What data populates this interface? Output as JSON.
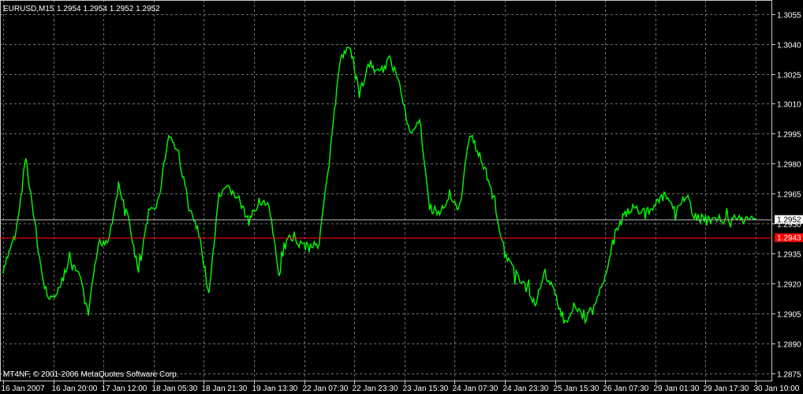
{
  "header": {
    "symbol_timeframe": "EURUSD,M15",
    "ohlc": "1.2954 1.2954 1.2952 1.2952"
  },
  "footer": {
    "copyright": "MT4NF, © 2001-2006 MetaQuotes Software Corp."
  },
  "colors": {
    "background": "#000000",
    "grid": "#6f6f6f",
    "price_line": "#00ff00",
    "bid_line": "#b0b0b0",
    "marker_line": "#ff0000",
    "marker_label_bg": "#ff0000",
    "current_label_bg": "#ffffff"
  },
  "chart_data": {
    "type": "line",
    "title": "EURUSD,M15",
    "ylim": [
      1.2871,
      1.3062
    ],
    "yticks": [
      "1.3055",
      "1.3040",
      "1.3025",
      "1.3010",
      "1.2995",
      "1.2980",
      "1.2965",
      "1.2950",
      "1.2935",
      "1.2920",
      "1.2905",
      "1.2890",
      "1.2875"
    ],
    "xticks": [
      "16 Jan 2007",
      "16 Jan 20:00",
      "17 Jan 12:00",
      "18 Jan 05:30",
      "18 Jan 21:30",
      "19 Jan 13:30",
      "22 Jan 07:30",
      "22 Jan 23:30",
      "23 Jan 15:30",
      "24 Jan 07:30",
      "24 Jan 23:30",
      "25 Jan 15:30",
      "26 Jan 07:30",
      "29 Jan 01:30",
      "29 Jan 17:30",
      "30 Jan 10:00"
    ],
    "current_price": "1.2952",
    "marker_price": "1.2943",
    "grid": true,
    "series": [
      {
        "x_tick_index": [
          0.0,
          0.3,
          0.45,
          0.6,
          0.8,
          0.95,
          1.1,
          1.3,
          1.5,
          1.7,
          1.9,
          2.1,
          2.3,
          2.5,
          2.7,
          2.9,
          3.1,
          3.3,
          3.5,
          3.7,
          3.9,
          4.1,
          4.3,
          4.5,
          4.7,
          4.9,
          5.1,
          5.3,
          5.5,
          5.7,
          5.9,
          6.1,
          6.3,
          6.5,
          6.7,
          6.9,
          7.0,
          7.1,
          7.3,
          7.5,
          7.7,
          7.9,
          8.1,
          8.3,
          8.5,
          8.7,
          8.9,
          9.1,
          9.3,
          9.4,
          9.6,
          9.8,
          10.0,
          10.2,
          10.4,
          10.6,
          10.8,
          11.0,
          11.2,
          11.4,
          11.6,
          11.8,
          12.0,
          12.2,
          12.4,
          12.6,
          12.8,
          13.0,
          13.2,
          13.4,
          13.6,
          13.8,
          14.0,
          14.2,
          14.4,
          14.6,
          14.8,
          15.0
        ],
        "y": [
          1.2925,
          1.2952,
          1.2984,
          1.2955,
          1.292,
          1.2912,
          1.2916,
          1.293,
          1.2925,
          1.2905,
          1.294,
          1.2942,
          1.2969,
          1.2952,
          1.2925,
          1.2955,
          1.2962,
          1.2995,
          1.2985,
          1.2958,
          1.2945,
          1.2915,
          1.2963,
          1.2968,
          1.2962,
          1.295,
          1.2962,
          1.2958,
          1.2925,
          1.2945,
          1.294,
          1.2938,
          1.2942,
          1.298,
          1.303,
          1.304,
          1.3028,
          1.3015,
          1.303,
          1.3025,
          1.3032,
          1.3022,
          1.2995,
          1.3003,
          1.2958,
          1.2955,
          1.2962,
          1.2958,
          1.2995,
          1.299,
          1.2978,
          1.296,
          1.2935,
          1.2925,
          1.292,
          1.291,
          1.2925,
          1.2915,
          1.29,
          1.291,
          1.2902,
          1.2908,
          1.2925,
          1.2945,
          1.2955,
          1.2958,
          1.2955,
          1.296,
          1.2964,
          1.2955,
          1.2965,
          1.2953,
          1.2952,
          1.2952,
          1.2952,
          1.2952,
          1.2952,
          1.2952
        ]
      }
    ]
  }
}
